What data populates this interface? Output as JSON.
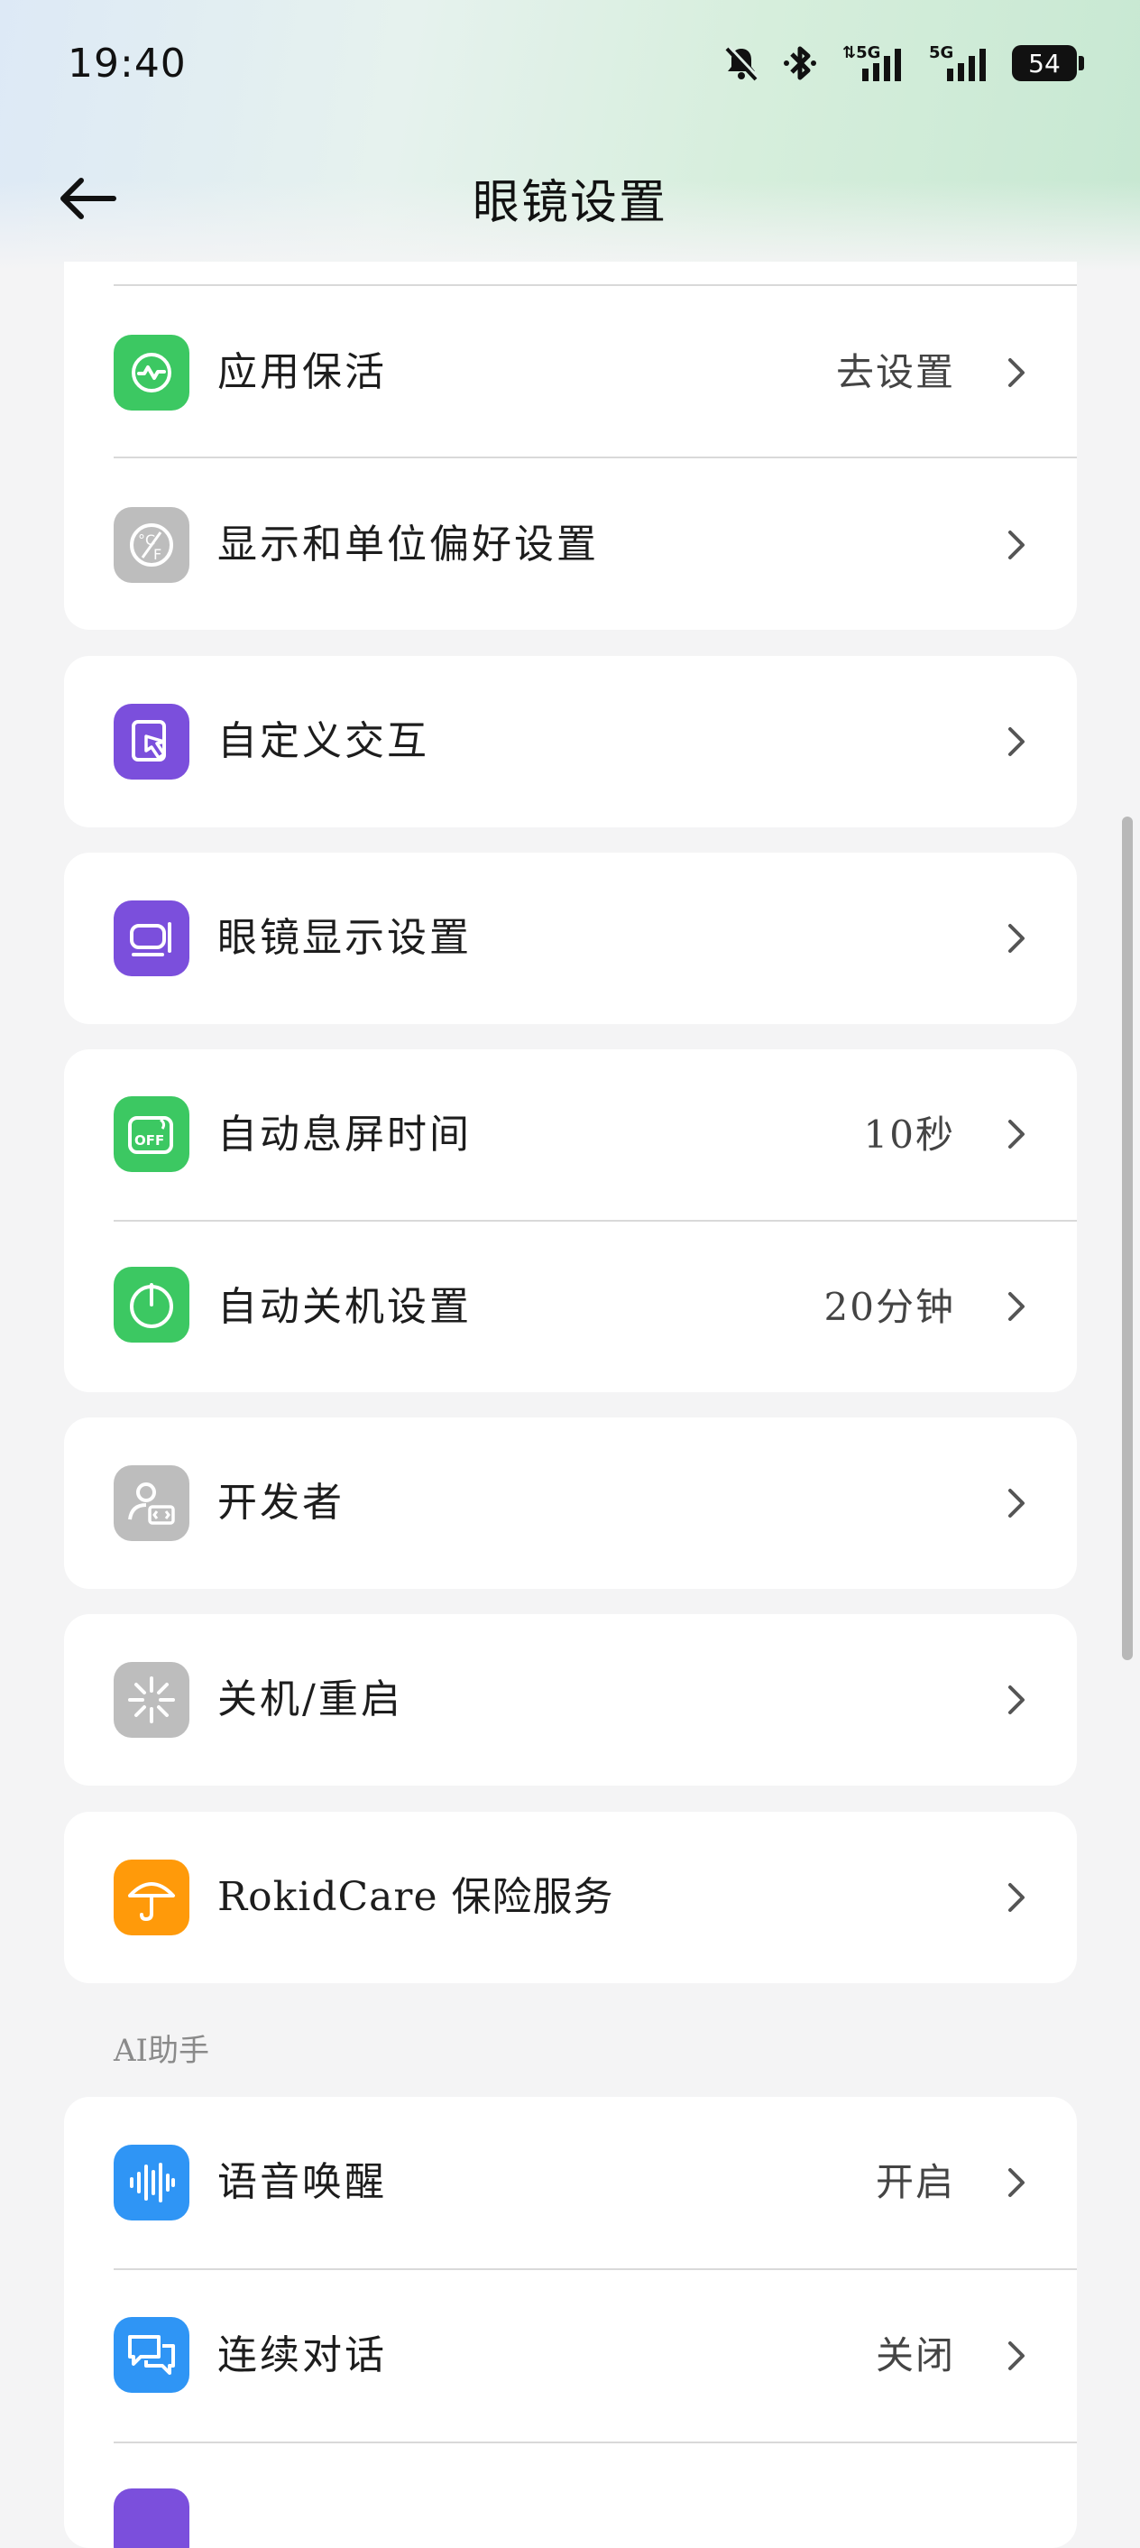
{
  "status_bar": {
    "time": "19:40",
    "battery": "54",
    "icons": [
      "mute-bell-icon",
      "bluetooth-icon",
      "5g-signal-icon",
      "5g-signal-icon",
      "battery-icon"
    ]
  },
  "header": {
    "title": "眼镜设置",
    "back_icon": "back-arrow-icon"
  },
  "groups": [
    {
      "items": [
        {
          "label": "应用保活",
          "value": "去设置",
          "icon": "keep-alive-icon",
          "icon_color": "#3cc862"
        },
        {
          "label": "显示和单位偏好设置",
          "value": "",
          "icon": "unit-preference-icon",
          "icon_color": "#bdbdbd"
        }
      ]
    },
    {
      "items": [
        {
          "label": "自定义交互",
          "value": "",
          "icon": "touch-gesture-icon",
          "icon_color": "#7b4fdc"
        }
      ]
    },
    {
      "items": [
        {
          "label": "眼镜显示设置",
          "value": "",
          "icon": "glasses-display-icon",
          "icon_color": "#7b4fdc"
        }
      ]
    },
    {
      "items": [
        {
          "label": "自动息屏时间",
          "value": "10秒",
          "icon": "screen-off-icon",
          "icon_color": "#3cc862"
        },
        {
          "label": "自动关机设置",
          "value": "20分钟",
          "icon": "power-icon",
          "icon_color": "#3cc862"
        }
      ]
    },
    {
      "items": [
        {
          "label": "开发者",
          "value": "",
          "icon": "developer-icon",
          "icon_color": "#bdbdbd"
        }
      ]
    },
    {
      "items": [
        {
          "label": "关机/重启",
          "value": "",
          "icon": "restart-icon",
          "icon_color": "#bdbdbd"
        }
      ]
    },
    {
      "items": [
        {
          "label": "RokidCare 保险服务",
          "value": "",
          "icon": "umbrella-icon",
          "icon_color": "#ff9a0a"
        }
      ]
    }
  ],
  "ai_section": {
    "title": "AI助手",
    "items": [
      {
        "label": "语音唤醒",
        "value": "开启",
        "icon": "voice-wave-icon",
        "icon_color": "#2f95f5"
      },
      {
        "label": "连续对话",
        "value": "关闭",
        "icon": "chat-bubbles-icon",
        "icon_color": "#2f95f5"
      }
    ]
  }
}
